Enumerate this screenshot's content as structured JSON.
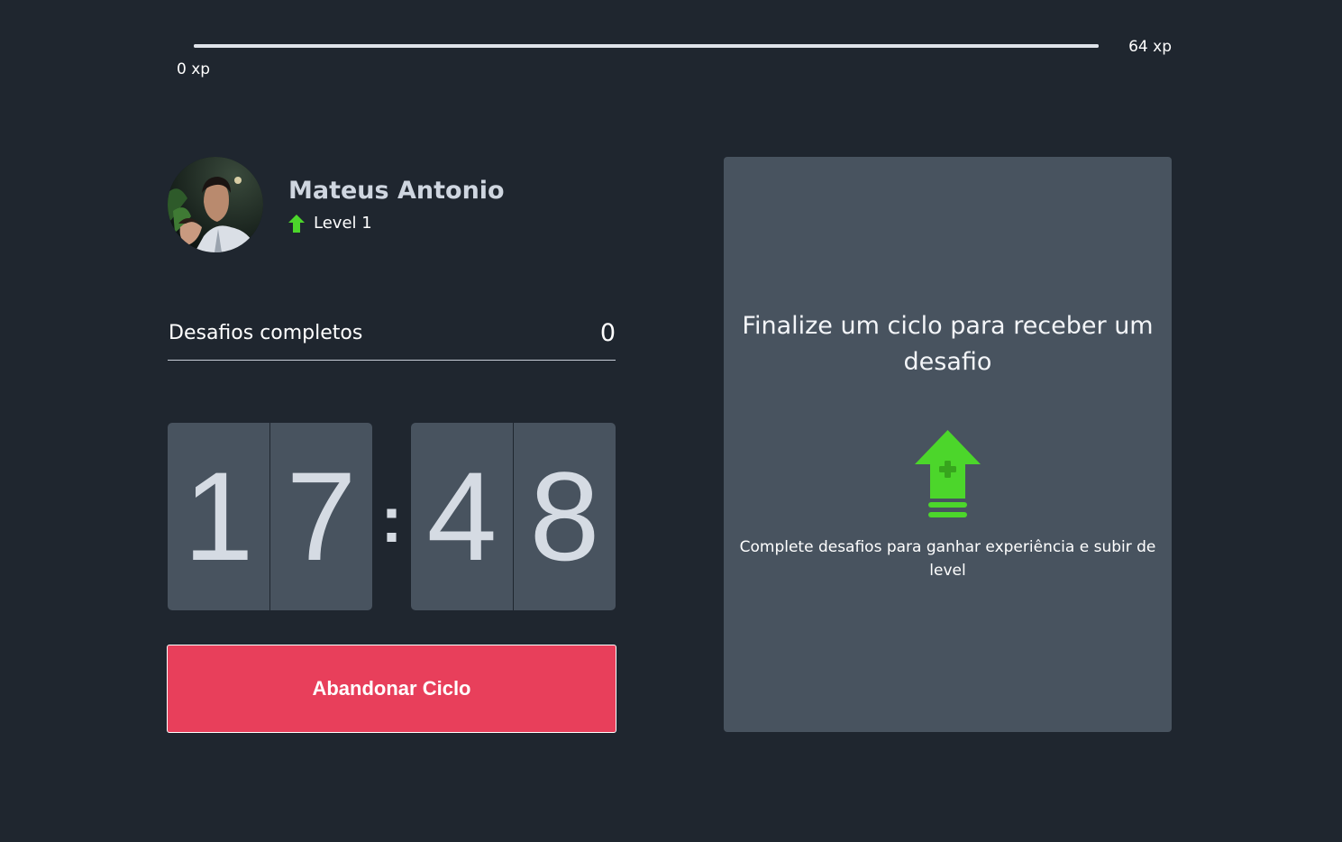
{
  "xp": {
    "min_label": "0 xp",
    "max_label": "64 xp",
    "progress_percent": 100
  },
  "profile": {
    "name": "Mateus Antonio",
    "level_label": "Level 1",
    "avatar_icon": "user-avatar-photo",
    "level_icon": "level-up-arrow-icon"
  },
  "completed": {
    "label": "Desafios completos",
    "count": "0"
  },
  "countdown": {
    "minute_left": "1",
    "minute_right": "7",
    "separator": ":",
    "second_left": "4",
    "second_right": "8"
  },
  "abandon_button": {
    "label": "Abandonar Ciclo"
  },
  "challenge_panel": {
    "title": "Finalize um ciclo para receber um desafio",
    "description": "Complete desafios para ganhar experiência e subir de level",
    "icon": "level-up-icon"
  },
  "colors": {
    "background": "#1f262f",
    "panel": "#48535f",
    "accent_green": "#4cd62b",
    "button_red": "#e83f5b",
    "digit_text": "#d5dbe3"
  }
}
